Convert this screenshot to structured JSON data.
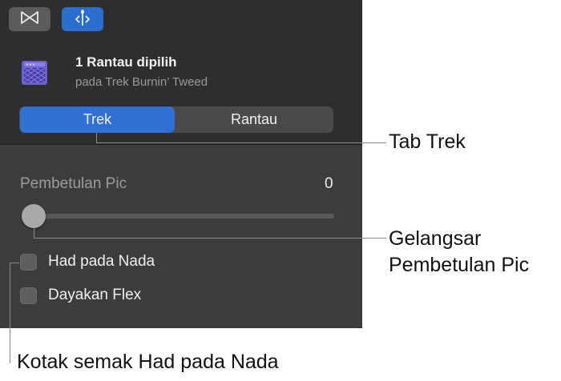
{
  "toolbar": {
    "editors_icon": "bowtie-icon",
    "smart_controls_icon": "scissors-cursor-icon"
  },
  "region": {
    "icon": "amp-region-icon",
    "title": "1 Rantau dipilih",
    "subtitle": "pada Trek Burnin’ Tweed"
  },
  "tabs": {
    "trek": "Trek",
    "rantau": "Rantau",
    "selected": "Trek"
  },
  "pitch": {
    "label": "Pembetulan Pic",
    "value": "0"
  },
  "checkboxes": {
    "limit_key": "Had pada Nada",
    "enable_flex": "Dayakan Flex"
  },
  "callouts": {
    "trek_tab": "Tab Trek",
    "slider_line1": "Gelangsar",
    "slider_line2": "Pembetulan Pic",
    "checkbox": "Kotak semak Had pada Nada"
  },
  "colors": {
    "accent": "#2f72d4",
    "panel_bg": "#3c3c3d"
  }
}
